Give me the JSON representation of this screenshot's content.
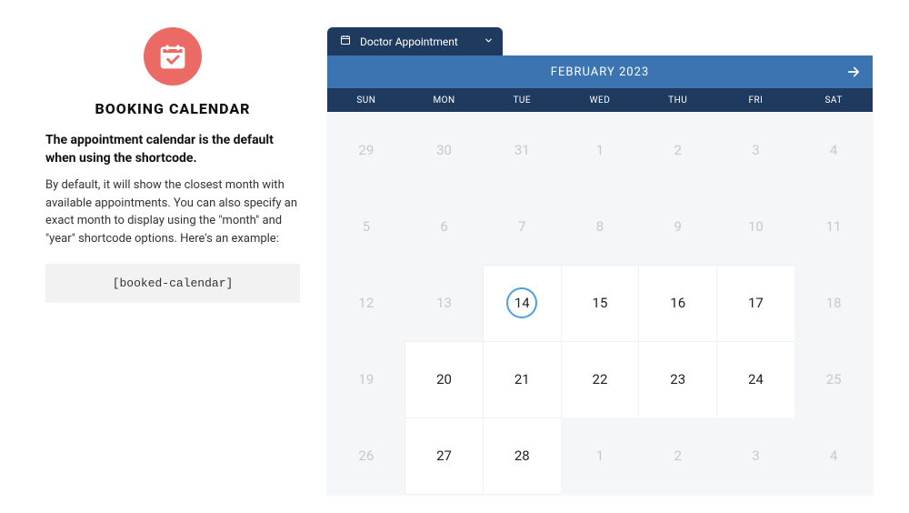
{
  "left": {
    "title": "BOOKING CALENDAR",
    "subtitle": "The appointment calendar is the default when using the shortcode.",
    "text": "By default, it will show the closest month with available appointments. You can also specify an exact month to display using the \"month\" and \"year\" shortcode options. Here's an example:",
    "code": "[booked-calendar]"
  },
  "tab": {
    "label": "Doctor Appointment"
  },
  "calendar": {
    "month_label": "FEBRUARY 2023",
    "weekdays": [
      "SUN",
      "MON",
      "TUE",
      "WED",
      "THU",
      "FRI",
      "SAT"
    ],
    "cells": [
      {
        "n": "29",
        "avail": false,
        "today": false
      },
      {
        "n": "30",
        "avail": false,
        "today": false
      },
      {
        "n": "31",
        "avail": false,
        "today": false
      },
      {
        "n": "1",
        "avail": false,
        "today": false
      },
      {
        "n": "2",
        "avail": false,
        "today": false
      },
      {
        "n": "3",
        "avail": false,
        "today": false
      },
      {
        "n": "4",
        "avail": false,
        "today": false
      },
      {
        "n": "5",
        "avail": false,
        "today": false
      },
      {
        "n": "6",
        "avail": false,
        "today": false
      },
      {
        "n": "7",
        "avail": false,
        "today": false
      },
      {
        "n": "8",
        "avail": false,
        "today": false
      },
      {
        "n": "9",
        "avail": false,
        "today": false
      },
      {
        "n": "10",
        "avail": false,
        "today": false
      },
      {
        "n": "11",
        "avail": false,
        "today": false
      },
      {
        "n": "12",
        "avail": false,
        "today": false
      },
      {
        "n": "13",
        "avail": false,
        "today": false
      },
      {
        "n": "14",
        "avail": true,
        "today": true
      },
      {
        "n": "15",
        "avail": true,
        "today": false
      },
      {
        "n": "16",
        "avail": true,
        "today": false
      },
      {
        "n": "17",
        "avail": true,
        "today": false
      },
      {
        "n": "18",
        "avail": false,
        "today": false
      },
      {
        "n": "19",
        "avail": false,
        "today": false
      },
      {
        "n": "20",
        "avail": true,
        "today": false
      },
      {
        "n": "21",
        "avail": true,
        "today": false
      },
      {
        "n": "22",
        "avail": true,
        "today": false
      },
      {
        "n": "23",
        "avail": true,
        "today": false
      },
      {
        "n": "24",
        "avail": true,
        "today": false
      },
      {
        "n": "25",
        "avail": false,
        "today": false
      },
      {
        "n": "26",
        "avail": false,
        "today": false
      },
      {
        "n": "27",
        "avail": true,
        "today": false
      },
      {
        "n": "28",
        "avail": true,
        "today": false
      },
      {
        "n": "1",
        "avail": false,
        "today": false
      },
      {
        "n": "2",
        "avail": false,
        "today": false
      },
      {
        "n": "3",
        "avail": false,
        "today": false
      },
      {
        "n": "4",
        "avail": false,
        "today": false
      }
    ]
  }
}
